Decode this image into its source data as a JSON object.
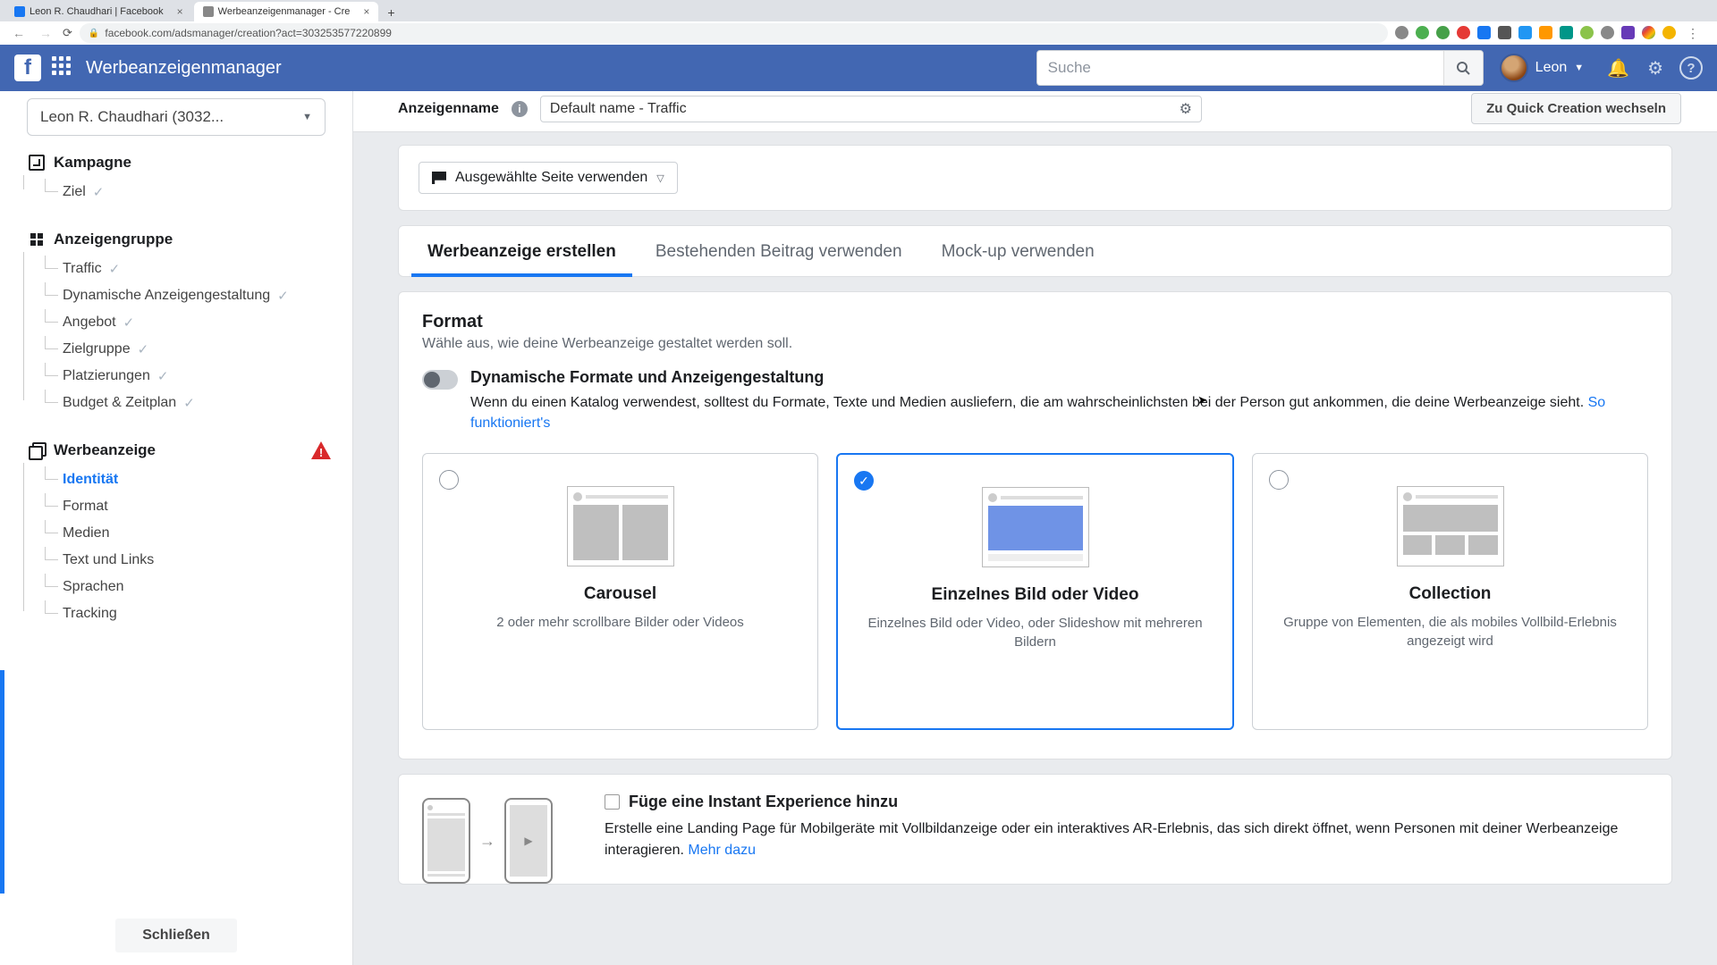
{
  "browser": {
    "tabs": [
      {
        "title": "Leon R. Chaudhari | Facebook",
        "active": false
      },
      {
        "title": "Werbeanzeigenmanager - Cre",
        "active": true
      }
    ],
    "url": "facebook.com/adsmanager/creation?act=303253577220899"
  },
  "topbar": {
    "app_title": "Werbeanzeigenmanager",
    "search_placeholder": "Suche",
    "user_name": "Leon"
  },
  "account": {
    "selected": "Leon R. Chaudhari (3032..."
  },
  "nav": {
    "campaign": {
      "label": "Kampagne",
      "items": [
        {
          "label": "Ziel",
          "checked": true
        }
      ]
    },
    "adset": {
      "label": "Anzeigengruppe",
      "items": [
        {
          "label": "Traffic",
          "checked": true
        },
        {
          "label": "Dynamische Anzeigengestaltung",
          "checked": true
        },
        {
          "label": "Angebot",
          "checked": true
        },
        {
          "label": "Zielgruppe",
          "checked": true
        },
        {
          "label": "Platzierungen",
          "checked": true
        },
        {
          "label": "Budget & Zeitplan",
          "checked": true
        }
      ]
    },
    "ad": {
      "label": "Werbeanzeige",
      "warning": true,
      "items": [
        {
          "label": "Identität",
          "active": true
        },
        {
          "label": "Format"
        },
        {
          "label": "Medien"
        },
        {
          "label": "Text und Links"
        },
        {
          "label": "Sprachen"
        },
        {
          "label": "Tracking"
        }
      ]
    },
    "close_label": "Schließen"
  },
  "header": {
    "name_label": "Anzeigenname",
    "name_value": "Default name - Traffic",
    "quick_label": "Zu Quick Creation wechseln"
  },
  "page_select": {
    "label": "Ausgewählte Seite verwenden"
  },
  "tabs": [
    {
      "label": "Werbeanzeige erstellen",
      "active": true
    },
    {
      "label": "Bestehenden Beitrag verwenden"
    },
    {
      "label": "Mock-up verwenden"
    }
  ],
  "format": {
    "title": "Format",
    "subtitle": "Wähle aus, wie deine Werbeanzeige gestaltet werden soll.",
    "dynamic": {
      "title": "Dynamische Formate und Anzeigengestaltung",
      "desc": "Wenn du einen Katalog verwendest, solltest du Formate, Texte und Medien ausliefern, die am wahrscheinlichsten bei der Person gut ankommen, die deine Werbeanzeige sieht. ",
      "link": "So funktioniert's"
    },
    "options": [
      {
        "title": "Carousel",
        "desc": "2 oder mehr scrollbare Bilder oder Videos",
        "selected": false
      },
      {
        "title": "Einzelnes Bild oder Video",
        "desc": "Einzelnes Bild oder Video, oder Slideshow mit mehreren Bildern",
        "selected": true
      },
      {
        "title": "Collection",
        "desc": "Gruppe von Elementen, die als mobiles Vollbild-Erlebnis angezeigt wird",
        "selected": false
      }
    ]
  },
  "instant": {
    "title": "Füge eine Instant Experience hinzu",
    "desc": "Erstelle eine Landing Page für Mobilgeräte mit Vollbildanzeige oder ein interaktives AR-Erlebnis, das sich direkt öffnet, wenn Personen mit deiner Werbeanzeige interagieren. ",
    "link": "Mehr dazu"
  }
}
